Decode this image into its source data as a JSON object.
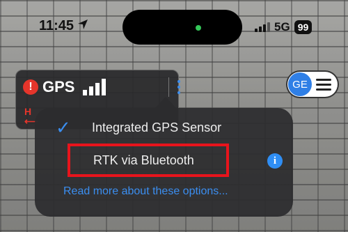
{
  "status_bar": {
    "time": "11:45",
    "location_icon": "navigation-arrow-icon",
    "network": "5G",
    "battery": "99"
  },
  "gps_widget": {
    "warning_icon_text": "!",
    "label": "GPS",
    "signal_icon": "signal-bars-icon",
    "menu_icon": "kebab-menu-icon",
    "h_icon_text": "H"
  },
  "toggle": {
    "label": "GE",
    "menu_icon": "hamburger-icon"
  },
  "popover": {
    "options": [
      {
        "label": "Integrated GPS Sensor",
        "selected": true
      },
      {
        "label": "RTK via Bluetooth",
        "selected": false,
        "highlighted": true
      }
    ],
    "info_icon_text": "i",
    "read_more": "Read more about these options..."
  },
  "colors": {
    "accent": "#3b8ef0",
    "warning": "#e5352b",
    "highlight_border": "#e8141c",
    "popover_bg": "#2c2c2e"
  }
}
